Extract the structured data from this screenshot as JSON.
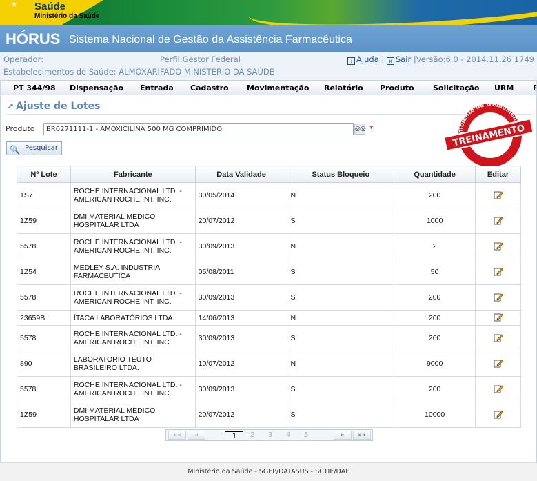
{
  "banner": {
    "brand_title": "Saúde",
    "brand_subtitle": "Ministério da Saúde"
  },
  "header": {
    "app_name": "HÓRUS",
    "app_subtitle": "Sistema Nacional de Gestão da Assistência Farmacêutica"
  },
  "infobar": {
    "operador": "Operador:",
    "perfil": "Perfil:Gestor Federal",
    "estabelecimento": "Estabelecimentos de Saúde: ALMOXARIFADO MINISTÉRIO DA SAÚDE",
    "ajuda": "Ajuda",
    "sair": "Sair",
    "versao": "|Versão:6.0 - 2014.11.26 1749"
  },
  "menu": [
    "PT 344/98",
    "Dispensação",
    "Entrada",
    "Cadastro",
    "Movimentação",
    "Relatório",
    "Produto",
    "Solicitação",
    "URM",
    "R"
  ],
  "page": {
    "title": "Ajuste de Lotes",
    "product_label": "Produto",
    "product_value": "BR0271111-1 - AMOXICILINA 500 MG COMPRIMIDO",
    "required_mark": "*",
    "search_button": "Pesquisar"
  },
  "stamp": {
    "top_text": "Ambiente de treinamento",
    "main_text": "TREINAMENTO",
    "bottom_text": "HÓRUS"
  },
  "table": {
    "headers": [
      "Nº Lote",
      "Fabricante",
      "Data Validade",
      "Status Bloqueio",
      "Quantidade",
      "Editar"
    ],
    "rows": [
      {
        "lote": "1S7",
        "fab1": "ROCHE INTERNACIONAL LTD. -",
        "fab2": "AMERICAN ROCHE INT. INC.",
        "validade": "30/05/2014",
        "status": "N",
        "qtd": "200"
      },
      {
        "lote": "1Z59",
        "fab1": "DMI MATERIAL MEDICO",
        "fab2": "HOSPITALAR LTDA",
        "validade": "20/07/2012",
        "status": "S",
        "qtd": "1000"
      },
      {
        "lote": "5578",
        "fab1": "ROCHE INTERNACIONAL LTD. -",
        "fab2": "AMERICAN ROCHE INT. INC.",
        "validade": "30/09/2013",
        "status": "N",
        "qtd": "2"
      },
      {
        "lote": "1Z54",
        "fab1": "MEDLEY S.A. INDUSTRIA",
        "fab2": "FARMACEUTICA",
        "validade": "05/08/2011",
        "status": "S",
        "qtd": "50"
      },
      {
        "lote": "5578",
        "fab1": "ROCHE INTERNACIONAL LTD. -",
        "fab2": "AMERICAN ROCHE INT. INC.",
        "validade": "30/09/2013",
        "status": "S",
        "qtd": "200"
      },
      {
        "lote": "23659B",
        "fab1": "ÍTACA LABORATÓRIOS LTDA.",
        "fab2": "",
        "validade": "14/06/2013",
        "status": "N",
        "qtd": "200"
      },
      {
        "lote": "5578",
        "fab1": "ROCHE INTERNACIONAL LTD. -",
        "fab2": "AMERICAN ROCHE INT. INC.",
        "validade": "30/09/2013",
        "status": "S",
        "qtd": "200"
      },
      {
        "lote": "890",
        "fab1": "LABORATORIO TEUTO",
        "fab2": "BRASILEIRO LTDA.",
        "validade": "10/07/2012",
        "status": "N",
        "qtd": "9000"
      },
      {
        "lote": "5578",
        "fab1": "ROCHE INTERNACIONAL LTD. -",
        "fab2": "AMERICAN ROCHE INT. INC.",
        "validade": "30/09/2013",
        "status": "S",
        "qtd": "200"
      },
      {
        "lote": "1Z59",
        "fab1": "DMI MATERIAL MEDICO",
        "fab2": "HOSPITALAR LTDA",
        "validade": "20/07/2012",
        "status": "S",
        "qtd": "10000"
      }
    ]
  },
  "pager": {
    "first": "««",
    "prev": "«",
    "pages": [
      "1",
      "2",
      "3",
      "4",
      "5"
    ],
    "current": "1",
    "next": "»",
    "last": "»»"
  },
  "footer": {
    "text": "Ministério da Saúde - SGEP/DATASUS - SCTIE/DAF"
  },
  "colors": {
    "title_blue": "#5b92c8",
    "info_text": "#6a8db8",
    "section_title": "#5b84b1",
    "stamp_red": "#d0141c"
  }
}
